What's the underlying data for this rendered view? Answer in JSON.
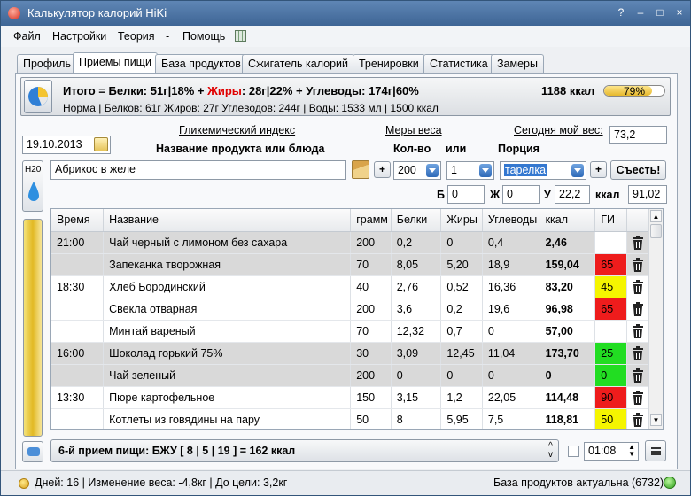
{
  "window": {
    "title": "Калькулятор калорий HiKi",
    "buttons": [
      "?",
      "–",
      "□",
      "×"
    ]
  },
  "menu": [
    "Файл",
    "Настройки",
    "Теория",
    "-",
    "Помощь"
  ],
  "tabs": [
    "Профиль",
    "Приемы пищи",
    "База продуктов",
    "Сжигатель калорий",
    "Тренировки",
    "Статистика",
    "Замеры"
  ],
  "active_tab": "Приемы пищи",
  "summary": {
    "line1_a": "Итого = Белки: 51г|18% + ",
    "line1_fat_label": "Жиры",
    "line1_b": ": 28г|22% + Углеводы: 174г|60%",
    "line2": "Норма | Белков: 61г Жиров: 27г Углеводов: 244г | Воды: 1533 мл | 1500 ккал",
    "kcal": "1188 ккал",
    "progress_label": "79%",
    "progress_value": 0.79
  },
  "controls": {
    "gi_link": "Гликемический индекс",
    "measures_link": "Меры веса",
    "weight_link": "Сегодня мой вес:",
    "weight_value": "73,2",
    "date": "19.10.2013",
    "product_header": "Название продукта или блюда",
    "qty_header": "Кол-во",
    "or_label": "или",
    "portion_header": "Порция",
    "product_value": "Абрикос в желе",
    "qty_value": "200",
    "count_value": "1",
    "portion_value": "тарелка",
    "eat_button": "Съесть!",
    "h2o_label": "H20",
    "b_label": "Б",
    "b_value": "0",
    "zh_label": "Ж",
    "zh_value": "0",
    "u_label": "У",
    "u_value": "22,2",
    "kcal_label": "ккал",
    "kcal_value": "91,02"
  },
  "table": {
    "headers": [
      "Время",
      "Название",
      "грамм",
      "Белки",
      "Жиры",
      "Углеводы",
      "ккал",
      "ГИ"
    ],
    "rows": [
      {
        "time": "21:00",
        "name": "Чай черный с лимоном без сахара",
        "gram": "200",
        "p": "0,2",
        "f": "0",
        "c": "0,4",
        "kcal": "2,46",
        "gi": "",
        "gi_color": "#ffffff",
        "shade": true
      },
      {
        "time": "",
        "name": "Запеканка творожная",
        "gram": "70",
        "p": "8,05",
        "f": "5,20",
        "c": "18,9",
        "kcal": "159,04",
        "gi": "65",
        "gi_color": "#ee1c1c",
        "shade": true
      },
      {
        "time": "18:30",
        "name": "Хлеб Бородинский",
        "gram": "40",
        "p": "2,76",
        "f": "0,52",
        "c": "16,36",
        "kcal": "83,20",
        "gi": "45",
        "gi_color": "#f5f500",
        "shade": false
      },
      {
        "time": "",
        "name": "Свекла отварная",
        "gram": "200",
        "p": "3,6",
        "f": "0,2",
        "c": "19,6",
        "kcal": "96,98",
        "gi": "65",
        "gi_color": "#ee1c1c",
        "shade": false
      },
      {
        "time": "",
        "name": "Минтай вареный",
        "gram": "70",
        "p": "12,32",
        "f": "0,7",
        "c": "0",
        "kcal": "57,00",
        "gi": "",
        "gi_color": "#ffffff",
        "shade": false
      },
      {
        "time": "16:00",
        "name": "Шоколад горький 75%",
        "gram": "30",
        "p": "3,09",
        "f": "12,45",
        "c": "11,04",
        "kcal": "173,70",
        "gi": "25",
        "gi_color": "#22dd22",
        "shade": true
      },
      {
        "time": "",
        "name": "Чай зеленый",
        "gram": "200",
        "p": "0",
        "f": "0",
        "c": "0",
        "kcal": "0",
        "gi": "0",
        "gi_color": "#22dd22",
        "shade": true
      },
      {
        "time": "13:30",
        "name": "Пюре картофельное",
        "gram": "150",
        "p": "3,15",
        "f": "1,2",
        "c": "22,05",
        "kcal": "114,48",
        "gi": "90",
        "gi_color": "#ee1c1c",
        "shade": false
      },
      {
        "time": "",
        "name": "Котлеты из говядины на пару",
        "gram": "50",
        "p": "8",
        "f": "5,95",
        "c": "7,5",
        "kcal": "118,81",
        "gi": "50",
        "gi_color": "#f5f500",
        "shade": false
      }
    ]
  },
  "bottom": {
    "meal_text": "6-й прием пищи:  БЖУ [ 8 | 5 | 19 ] = 162 ккал",
    "time_value": "01:08"
  },
  "status": {
    "left": "Дней: 16 | Изменение веса: -4,8кг | До цели: 3,2кг",
    "right": "База продуктов актуальна (6732)"
  },
  "colors": {
    "title_bar": "#4a72a4",
    "gi_red": "#ee1c1c",
    "gi_yellow": "#f5f500",
    "gi_green": "#22dd22"
  }
}
